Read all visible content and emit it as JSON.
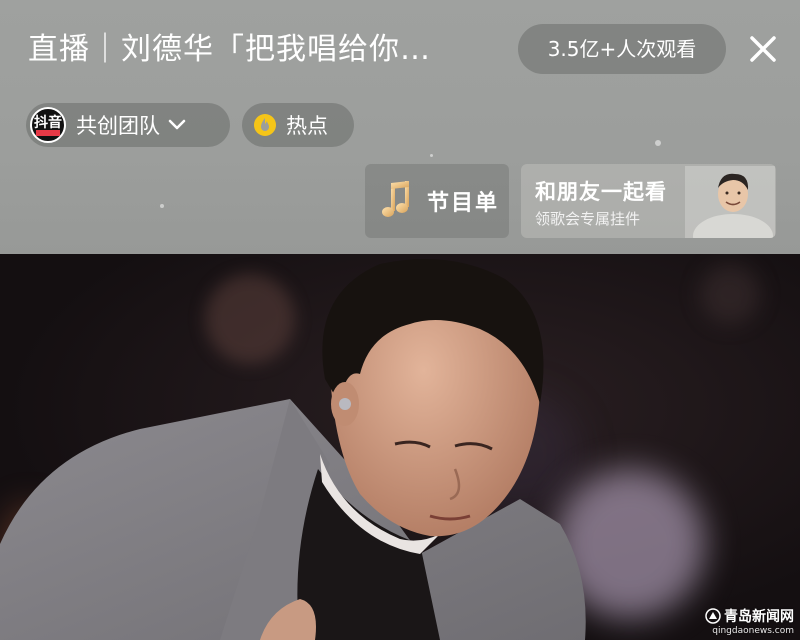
{
  "header": {
    "title": "直播｜刘德华「把我唱给你…",
    "viewer_count": "3.5亿+人次观看",
    "close_icon": "close-icon"
  },
  "tags": {
    "team_logo_text": "抖音",
    "team_label": "共创团队",
    "team_chevron": "chevron-down-icon",
    "hot_label": "热点",
    "hot_icon": "flame-icon",
    "hot_icon_color": "#f5c518"
  },
  "cards": {
    "program_label": "节目单",
    "program_icon": "music-note-icon",
    "watch_title": "和朋友一起看",
    "watch_subtitle": "领歌会专属挂件"
  },
  "video": {
    "watermark_name": "青岛新闻网",
    "watermark_url": "qingdaonews.com"
  }
}
